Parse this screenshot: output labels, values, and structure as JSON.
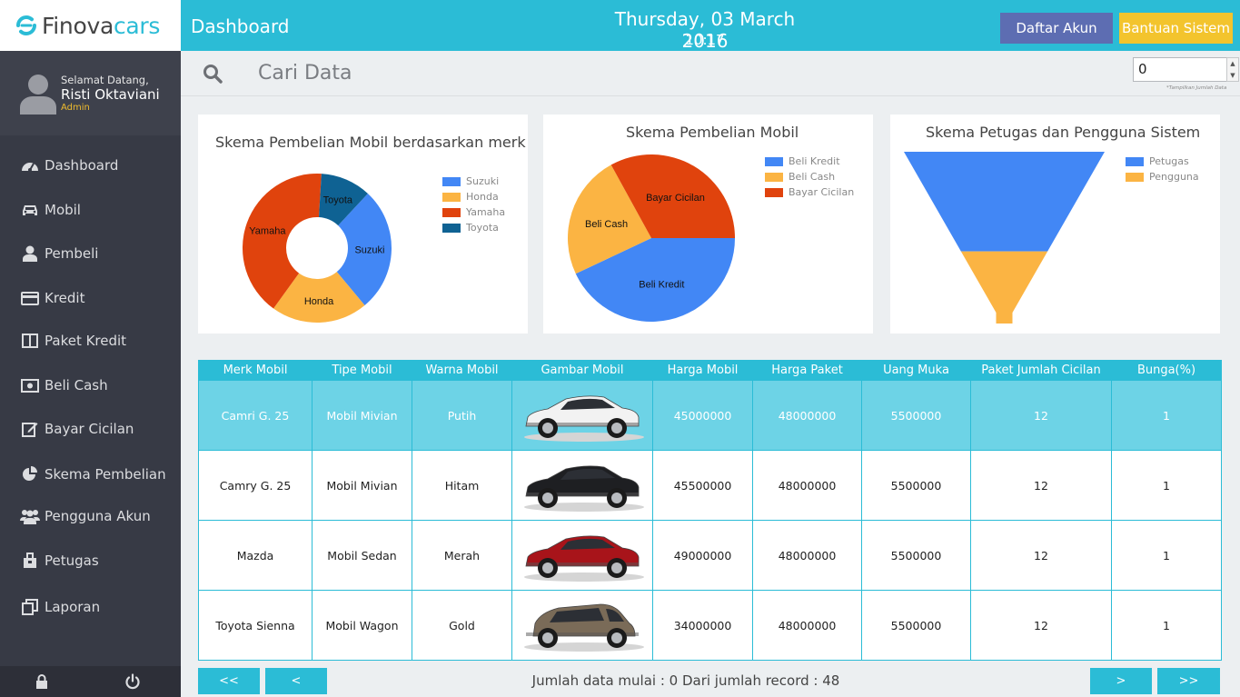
{
  "brand": {
    "name_part1": "Finova",
    "name_part2": "cars"
  },
  "user": {
    "greeting": "Selamat Datang,",
    "name": "Risti Oktaviani",
    "role": "Admin"
  },
  "sidebar": {
    "items": [
      {
        "label": "Dashboard",
        "icon": "dashboard-icon"
      },
      {
        "label": "Mobil",
        "icon": "car-icon"
      },
      {
        "label": "Pembeli",
        "icon": "user-icon"
      },
      {
        "label": "Kredit",
        "icon": "credit-card-icon"
      },
      {
        "label": "Paket Kredit",
        "icon": "columns-icon"
      },
      {
        "label": "Beli Cash",
        "icon": "money-icon"
      },
      {
        "label": "Bayar Cicilan",
        "icon": "edit-icon"
      },
      {
        "label": "Skema Pembelian",
        "icon": "pie-chart-icon"
      },
      {
        "label": "Pengguna Akun",
        "icon": "users-icon"
      },
      {
        "label": "Petugas",
        "icon": "briefcase-icon"
      },
      {
        "label": "Laporan",
        "icon": "copy-icon"
      }
    ],
    "bottom_icons": [
      "lock-icon",
      "power-icon"
    ]
  },
  "header": {
    "title": "Dashboard",
    "date": "Thursday, 03 March 2016",
    "time": "10:17",
    "daftar_label": "Daftar Akun",
    "bantuan_label": "Bantuan Sistem"
  },
  "search": {
    "label": "Cari Data",
    "count_value": "0",
    "count_hint": "*Tampilkan Jumlah Data"
  },
  "colors": {
    "accent": "#2bbcd6",
    "blue": "#4287f5",
    "orange": "#fbb443",
    "red": "#e0430d",
    "navy": "#0f6293",
    "purple": "#5d6db2",
    "yellow": "#f3c42d"
  },
  "charts": [
    {
      "title": "Skema Pembelian Mobil berdasarkan merk",
      "legend": [
        "Suzuki",
        "Honda",
        "Yamaha",
        "Toyota"
      ],
      "slice_labels": [
        "Suzuki",
        "Honda",
        "Yamaha",
        "Toyota"
      ]
    },
    {
      "title": "Skema Pembelian Mobil",
      "legend": [
        "Beli Kredit",
        "Beli Cash",
        "Bayar Cicilan"
      ],
      "slice_labels": [
        "Beli Kredit",
        "Beli Cash",
        "Bayar Cicilan"
      ]
    },
    {
      "title": "Skema Petugas dan Pengguna Sistem",
      "legend": [
        "Petugas",
        "Pengguna"
      ]
    }
  ],
  "chart_data": [
    {
      "type": "pie",
      "title": "Skema Pembelian Mobil berdasarkan merk",
      "categories": [
        "Suzuki",
        "Honda",
        "Yamaha",
        "Toyota"
      ],
      "values": [
        27,
        21,
        41,
        11
      ],
      "colors": [
        "#4287f5",
        "#fbb443",
        "#e0430d",
        "#0f6293"
      ],
      "donut": true
    },
    {
      "type": "pie",
      "title": "Skema Pembelian Mobil",
      "categories": [
        "Beli Kredit",
        "Beli Cash",
        "Bayar Cicilan"
      ],
      "values": [
        43,
        24,
        33
      ],
      "colors": [
        "#4287f5",
        "#fbb443",
        "#e0430d"
      ]
    },
    {
      "type": "funnel",
      "title": "Skema Petugas dan Pengguna Sistem",
      "categories": [
        "Petugas",
        "Pengguna"
      ],
      "values": [
        58,
        42
      ],
      "colors": [
        "#4287f5",
        "#fbb443"
      ]
    }
  ],
  "table": {
    "headers": [
      "Merk Mobil",
      "Tipe Mobil",
      "Warna Mobil",
      "Gambar Mobil",
      "Harga Mobil",
      "Harga Paket",
      "Uang Muka",
      "Paket Jumlah Cicilan",
      "Bunga(%)"
    ],
    "rows": [
      {
        "merk": "Camri G. 25",
        "tipe": "Mobil Mivian",
        "warna": "Putih",
        "car_color": "#f2f2f2",
        "harga": "45000000",
        "paket": "48000000",
        "dp": "5500000",
        "cicilan": "12",
        "bunga": "1"
      },
      {
        "merk": "Camry G. 25",
        "tipe": "Mobil Mivian",
        "warna": "Hitam",
        "car_color": "#1e1f22",
        "harga": "45500000",
        "paket": "48000000",
        "dp": "5500000",
        "cicilan": "12",
        "bunga": "1"
      },
      {
        "merk": "Mazda",
        "tipe": "Mobil Sedan",
        "warna": "Merah",
        "car_color": "#a8141a",
        "harga": "49000000",
        "paket": "48000000",
        "dp": "5500000",
        "cicilan": "12",
        "bunga": "1"
      },
      {
        "merk": "Toyota Sienna",
        "tipe": "Mobil Wagon",
        "warna": "Gold",
        "car_color": "#7a6b58",
        "harga": "34000000",
        "paket": "48000000",
        "dp": "5500000",
        "cicilan": "12",
        "bunga": "1"
      }
    ]
  },
  "pager": {
    "first": "<<",
    "prev": "<",
    "next": ">",
    "last": ">>",
    "info": "Jumlah data mulai : 0 Dari jumlah record : 48"
  }
}
